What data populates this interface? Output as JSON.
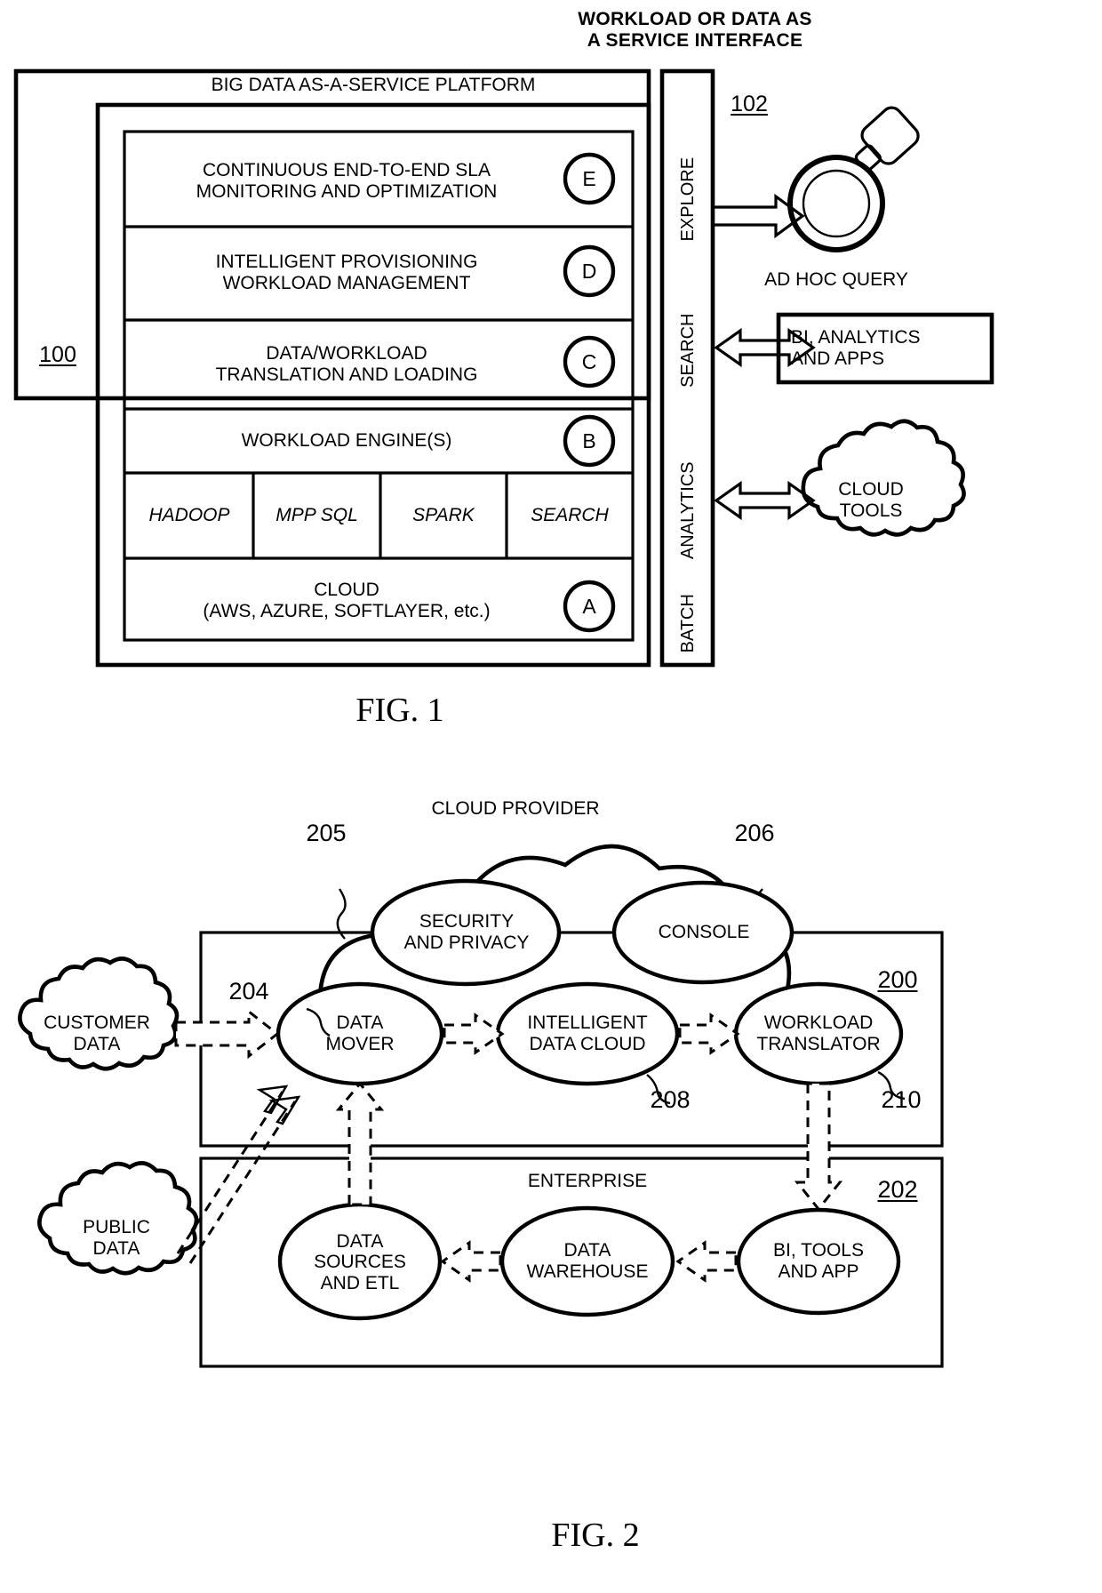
{
  "figure1": {
    "caption": "FIG. 1",
    "interface_title": "WORKLOAD OR DATA AS\nA SERVICE INTERFACE",
    "platform_title": "BIG DATA AS-A-SERVICE PLATFORM",
    "ref_platform": "100",
    "ref_interface": "102",
    "layers": [
      {
        "label": "CONTINUOUS END-TO-END SLA\nMONITORING AND OPTIMIZATION",
        "badge": "E"
      },
      {
        "label": "INTELLIGENT PROVISIONING\nWORKLOAD MANAGEMENT",
        "badge": "D"
      },
      {
        "label": "DATA/WORKLOAD\nTRANSLATION AND LOADING",
        "badge": "C"
      },
      {
        "label": "WORKLOAD ENGINE(S)",
        "badge": "B"
      },
      {
        "label": "CLOUD\n(AWS, AZURE, SOFTLAYER, etc.)",
        "badge": "A"
      }
    ],
    "engines": [
      "HADOOP",
      "MPP SQL",
      "SPARK",
      "SEARCH"
    ],
    "interface_modes": [
      "EXPLORE",
      "SEARCH",
      "ANALYTICS",
      "BATCH"
    ],
    "consumers": [
      {
        "label": "AD HOC QUERY",
        "icon": "magnifier-icon"
      },
      {
        "label": "BI, ANALYTICS\nAND APPS",
        "icon": "box-shape"
      },
      {
        "label": "CLOUD\nTOOLS",
        "icon": "cloud-shape"
      }
    ]
  },
  "figure2": {
    "caption": "FIG. 2",
    "cloud_provider_label": "CLOUD PROVIDER",
    "enterprise_label": "ENTERPRISE",
    "ref_cloud_platform": "200",
    "ref_enterprise": "202",
    "ref_data_mover": "204",
    "ref_cloud_provider": "205",
    "ref_console": "206",
    "ref_intelligent_data_cloud": "208",
    "ref_workload_translator": "210",
    "top_nodes": [
      {
        "label": "SECURITY\nAND PRIVACY"
      },
      {
        "label": "CONSOLE"
      }
    ],
    "mid_nodes": [
      {
        "label": "DATA\nMOVER"
      },
      {
        "label": "INTELLIGENT\nDATA  CLOUD"
      },
      {
        "label": "WORKLOAD\nTRANSLATOR"
      }
    ],
    "source_clouds": [
      {
        "label": "CUSTOMER\nDATA"
      },
      {
        "label": "PUBLIC\nDATA"
      }
    ],
    "enterprise_nodes": [
      {
        "label": "DATA\nSOURCES\nAND ETL"
      },
      {
        "label": "DATA\nWAREHOUSE"
      },
      {
        "label": "BI, TOOLS\nAND APP"
      }
    ]
  },
  "colors": {
    "ink": "#000000",
    "paper": "#ffffff"
  }
}
